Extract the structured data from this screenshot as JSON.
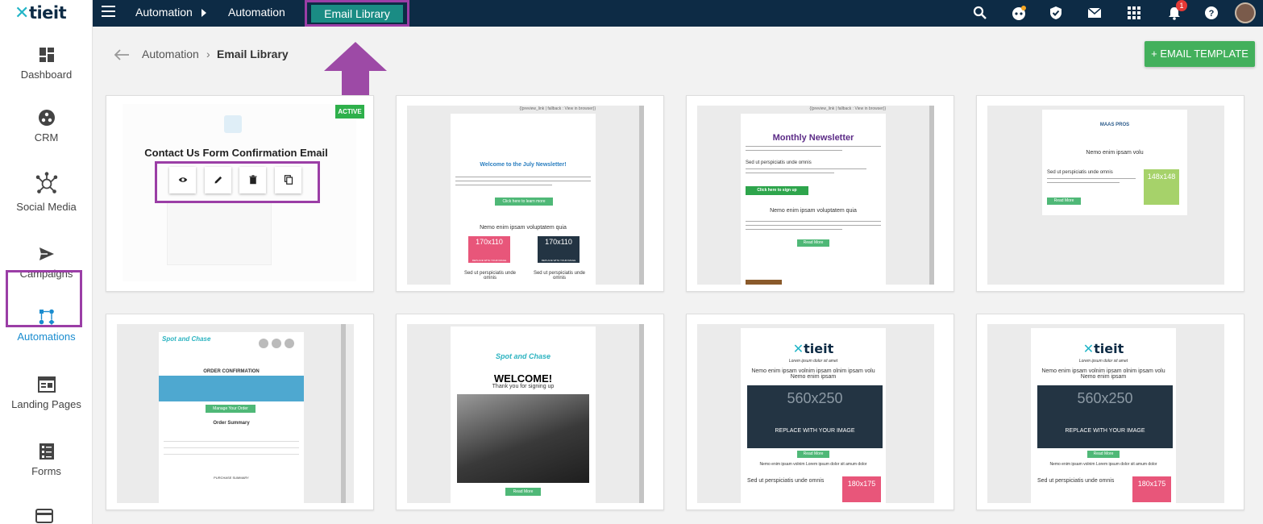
{
  "logo": {
    "text": "tieit"
  },
  "topnav": {
    "crumb1": "Automation",
    "crumb2": "Automation",
    "active_tab": "Email Library",
    "notifications_count": "1"
  },
  "sidebar": {
    "items": [
      {
        "label": "Dashboard"
      },
      {
        "label": "CRM"
      },
      {
        "label": "Social Media"
      },
      {
        "label": "Campaigns"
      },
      {
        "label": "Automations"
      },
      {
        "label": "Landing Pages"
      },
      {
        "label": "Forms"
      }
    ]
  },
  "breadcrumb": {
    "parent": "Automation",
    "current": "Email Library"
  },
  "add_button": "+ EMAIL TEMPLATE",
  "cards": [
    {
      "title": "Contact Us Form Confirmation Email",
      "status": "ACTIVE"
    },
    {
      "preview_link": "{{preview_link | fallback : View in browser}}",
      "heading": "Welcome to the July Newsletter!",
      "button": "Click here to learn more",
      "subheading": "Nemo enim ipsam voluptatem quia",
      "ph1": "170x110",
      "ph1_sub": "REPLACE WITH YOUR IMAGE",
      "ph2": "170x110",
      "ph2_sub": "REPLACE WITH YOUR IMAGE",
      "col_text": "Sed ut perspiciatis unde omnis"
    },
    {
      "preview_link": "{{preview_link | fallback : View in browser}}",
      "heading": "Monthly Newsletter",
      "subheading1": "Sed ut perspiciatis unde omnis",
      "button": "Click here to sign up",
      "subheading2": "Nemo enim ipsam voluptatem quia",
      "read_more": "Read More"
    },
    {
      "brand": "MAAS PROS",
      "heading": "Nemo enim ipsam volu",
      "subheading": "Sed ut perspiciatis unde omnis",
      "ph": "148x148",
      "read_more": "Read More"
    },
    {
      "brand": "Spot and Chase",
      "heading": "ORDER CONFIRMATION",
      "button": "Manage Your Order",
      "summary": "Order Summary",
      "purchase": "PURCHASE SUMMARY"
    },
    {
      "brand": "Spot and Chase",
      "heading": "WELCOME!",
      "subheading": "Thank you for signing up",
      "read_more": "Read More"
    },
    {
      "brand": "tieit",
      "tagline": "Lorem ipsum dolor sit amet",
      "heading": "Nemo enim ipsam volnim ipsam olnim ipsam volu Nemo enim ipsam",
      "ph": "560x250",
      "ph_sub": "REPLACE WITH YOUR IMAGE",
      "read_more": "Read More",
      "line": "Nemo enim ipsam volnim Lorem ipsum dolor sit amum dolor",
      "subheading": "Sed ut perspiciatis unde omnis",
      "ph2": "180x175"
    },
    {
      "brand": "tieit",
      "tagline": "Lorem ipsum dolor sit amet",
      "heading": "Nemo enim ipsam volnim ipsam olnim ipsam volu Nemo enim ipsam",
      "ph": "560x250",
      "ph_sub": "REPLACE WITH YOUR IMAGE",
      "read_more": "Read More",
      "line": "Nemo enim ipsam volnim Lorem ipsum dolor sit amum dolor",
      "subheading": "Sed ut perspiciatis unde omnis",
      "ph2": "180x175"
    }
  ],
  "colors": {
    "topbar": "#0d2b45",
    "accent": "#9b3ea6",
    "green": "#43b05c",
    "tab": "#1a8c84"
  }
}
